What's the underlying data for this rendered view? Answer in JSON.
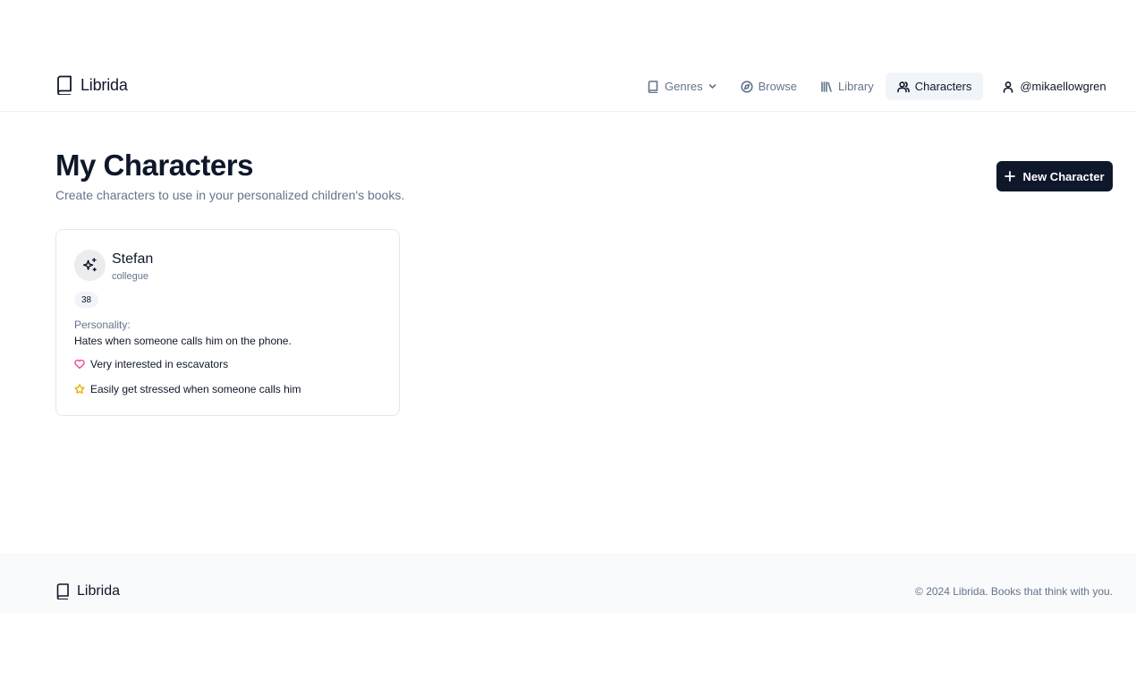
{
  "brand": {
    "name": "Librida"
  },
  "nav": {
    "items": [
      {
        "label": "Genres",
        "icon": "book-icon",
        "has_dropdown": true,
        "active": false
      },
      {
        "label": "Browse",
        "icon": "compass-icon",
        "active": false
      },
      {
        "label": "Library",
        "icon": "library-icon",
        "active": false
      },
      {
        "label": "Characters",
        "icon": "users-icon",
        "active": true
      }
    ],
    "user": {
      "label": "@mikaellowgren",
      "icon": "user-icon"
    }
  },
  "page": {
    "title": "My Characters",
    "subtitle": "Create characters to use in your personalized children's books.",
    "new_button_label": "New Character"
  },
  "characters": [
    {
      "name": "Stefan",
      "role": "collegue",
      "age": "38",
      "personality_label": "Personality:",
      "personality": "Hates when someone calls him on the phone.",
      "likes": "Very interested in escavators",
      "fears": "Easily get stressed when someone calls him",
      "avatar_icon": "sparkles-icon"
    }
  ],
  "footer": {
    "brand": "Librida",
    "copyright": "© 2024 Librida. Books that think with you."
  },
  "colors": {
    "primary": "#0f172a",
    "muted_text": "#64748b",
    "active_bg": "#f1f5f9",
    "like_icon": "#ec4899",
    "fear_icon": "#eab308",
    "footer_bg": "#f8fafc"
  }
}
